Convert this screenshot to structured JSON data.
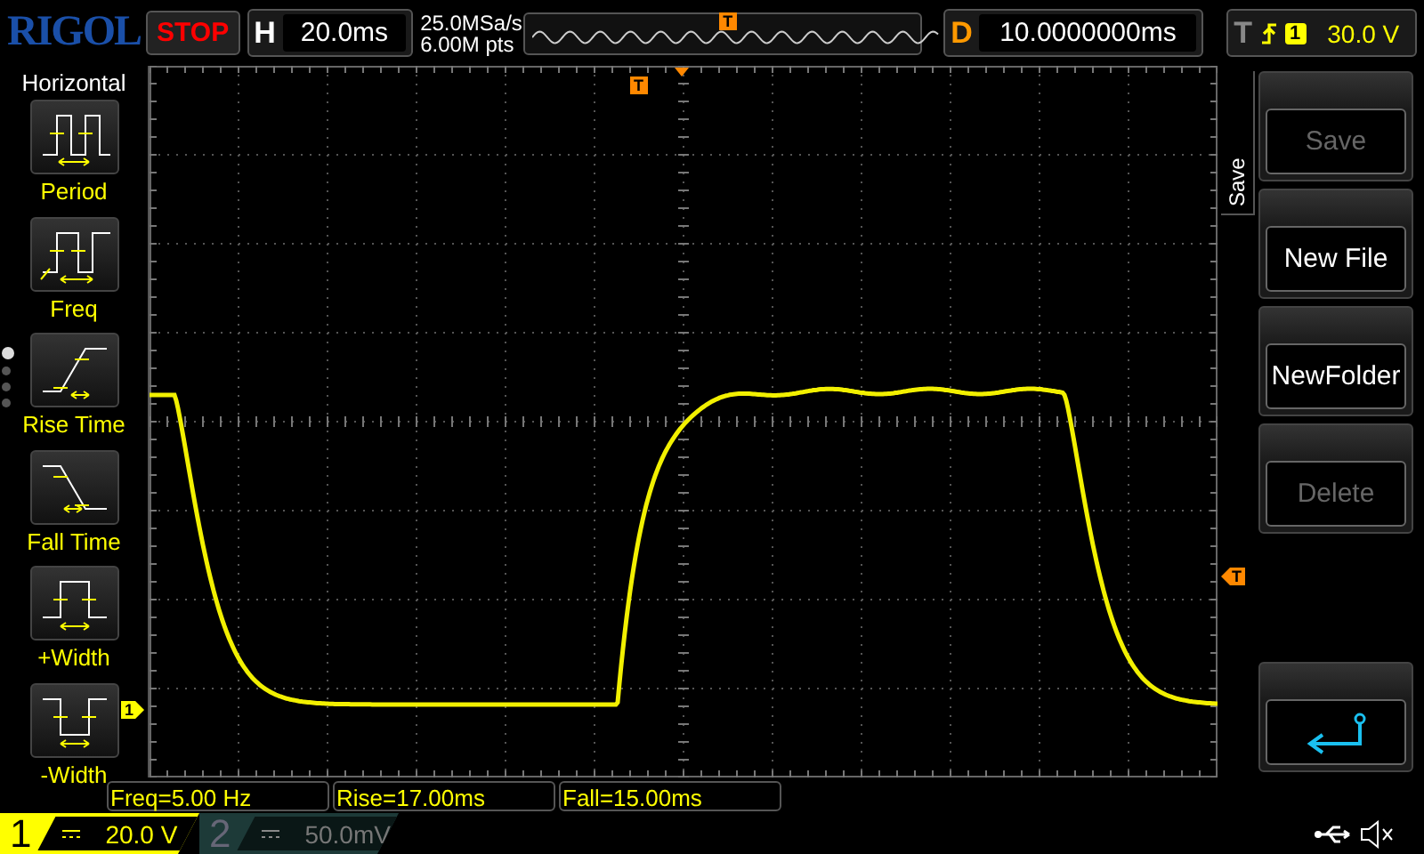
{
  "header": {
    "logo": "RIGOL",
    "run_state": "STOP",
    "timebase_label": "H",
    "timebase": "20.0ms",
    "sample_rate": "25.0MSa/s",
    "memory_depth": "6.00M pts",
    "overview_trigger": "T",
    "delay_label": "D",
    "delay": "10.0000000ms",
    "trigger_label": "T",
    "trigger_source": "1",
    "trigger_level": "30.0 V"
  },
  "measure_menu": {
    "title": "Horizontal",
    "items": [
      {
        "kind": "period",
        "label": "Period"
      },
      {
        "kind": "freq",
        "label": "Freq"
      },
      {
        "kind": "rise",
        "label": "Rise Time"
      },
      {
        "kind": "fall",
        "label": "Fall Time"
      },
      {
        "kind": "pwidth",
        "label": "+Width"
      },
      {
        "kind": "nwidth",
        "label": "-Width"
      }
    ],
    "pages": [
      {
        "selected": true
      },
      {
        "selected": false
      },
      {
        "selected": false
      },
      {
        "selected": false
      }
    ]
  },
  "display": {
    "trigger_position_marker": "T",
    "trigger_level_marker": "T",
    "channel_marker": "1"
  },
  "save_menu": {
    "title": "Save",
    "buttons": [
      {
        "kind": "text",
        "label": "Save",
        "disabled": true
      },
      {
        "kind": "text",
        "label": "New File",
        "disabled": false
      },
      {
        "kind": "text",
        "label": "NewFolder",
        "disabled": false
      },
      {
        "kind": "text",
        "label": "Delete",
        "disabled": true
      },
      {
        "kind": "back"
      }
    ]
  },
  "measurements": [
    "Freq=5.00 Hz",
    "Rise=17.00ms",
    "Fall=15.00ms"
  ],
  "channels": [
    {
      "number": "1",
      "scale": "20.0 V",
      "on": true
    },
    {
      "number": "2",
      "scale": "50.0mV",
      "on": false
    }
  ]
}
